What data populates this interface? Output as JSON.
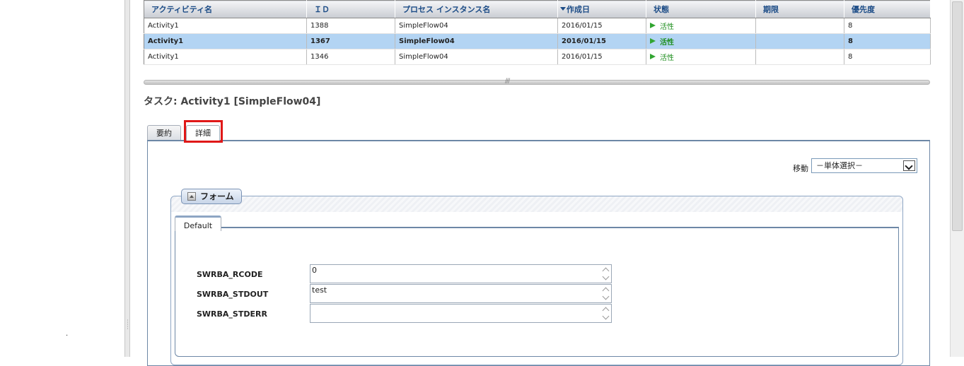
{
  "left_pane": {
    "dot": "."
  },
  "table": {
    "headers": [
      "アクティビティ名",
      "ＩＤ",
      "プロセス インスタンス名",
      "作成日",
      "状態",
      "期限",
      "優先度"
    ],
    "rows": [
      {
        "activity": "Activity1",
        "id": "1388",
        "process": "SimpleFlow04",
        "created": "2016/01/15",
        "status": "活性",
        "deadline": "",
        "priority": "8"
      },
      {
        "activity": "Activity1",
        "id": "1367",
        "process": "SimpleFlow04",
        "created": "2016/01/15",
        "status": "活性",
        "deadline": "",
        "priority": "8"
      },
      {
        "activity": "Activity1",
        "id": "1346",
        "process": "SimpleFlow04",
        "created": "2016/01/15",
        "status": "活性",
        "deadline": "",
        "priority": "8"
      }
    ],
    "selected_row": 1,
    "status_color": "#1f8f1f"
  },
  "task_title": "タスク: Activity1 [SimpleFlow04]",
  "tabs": [
    {
      "label": "要約"
    },
    {
      "label": "詳細"
    }
  ],
  "move": {
    "label": "移動",
    "selected": "－単体選択－"
  },
  "form": {
    "legend": "フォーム",
    "inner_tab": "Default",
    "fields": [
      {
        "label": "SWRBA_RCODE",
        "value": "0"
      },
      {
        "label": "SWRBA_STDOUT",
        "value": "test"
      },
      {
        "label": "SWRBA_STDERR",
        "value": ""
      }
    ]
  },
  "colors": {
    "highlight": "#e01818",
    "selected_row": "#b3d4f3",
    "header_text": "#1b4b86"
  }
}
